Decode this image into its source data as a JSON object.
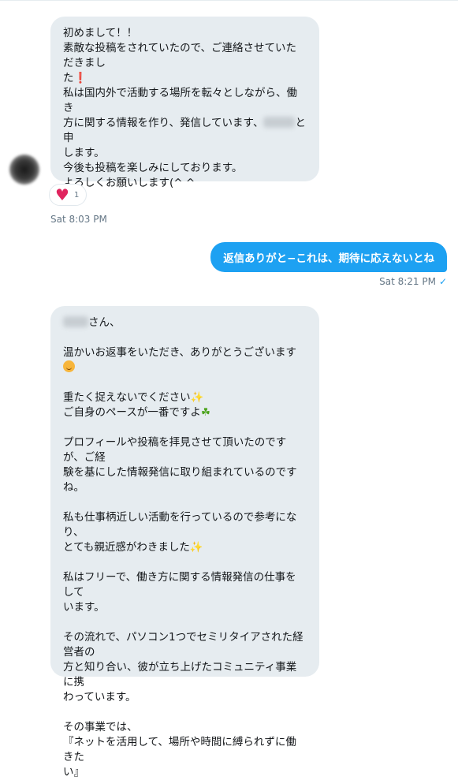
{
  "conversation": {
    "message1": {
      "lines": [
        "初めまして！！",
        "素敵な投稿をされていたので、ご連絡させていただきまし",
        "た",
        "",
        "私は国内外で活動する場所を転々としながら、働き",
        "方に関する情報を作り、発信しています、",
        "します。",
        "",
        "今後も投稿を楽しみにしております。",
        "よろしくお願いします(^ ^"
      ],
      "name_suffix": "と申",
      "red_mark": "❗",
      "reaction_icon": "heart-icon",
      "reaction_count": "1",
      "timestamp": "Sat 8:03 PM"
    },
    "reply": {
      "text": "返信ありがと−これは、期待に応えないとね",
      "timestamp": "Sat 8:21 PM",
      "read_icon": "check-icon",
      "color": "#1da1f2"
    },
    "message2": {
      "greeting_suffix": "さん、",
      "p1": "温かいお返事をいただき、ありがとうございます",
      "p2a": "重たく捉えないでください",
      "p2b": "ご自身のペースが一番ですよ",
      "p3": "プロフィールや投稿を拝見させて頂いたのですが、ご経\n験を基にした情報発信に取り組まれているのですね。",
      "p4a": "私も仕事柄近しい活動を行っているので参考になり、",
      "p4b": "とても親近感がわきました",
      "p5": "私はフリーで、働き方に関する情報発信の仕事をして\nいます。",
      "p6": "その流れで、パソコン1つでセミリタイアされた経営者の\n方と知り合い、彼が立ち上げたコミュニティ事業に携\nわっています。",
      "p7": "その事業では、\n『ネットを活用して、場所や時間に縛られずに働きた\nい』",
      "sparkle": "✨",
      "clover": "☘"
    }
  },
  "colors": {
    "incoming_bubble": "#e6ecf0",
    "outgoing_bubble": "#1da1f2",
    "timestamp": "#657786"
  }
}
